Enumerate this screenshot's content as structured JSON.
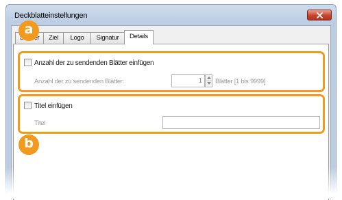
{
  "window": {
    "title": "Deckblatteinstellungen"
  },
  "tabs": [
    {
      "label": "Sender",
      "active": false
    },
    {
      "label": "Ziel",
      "active": false
    },
    {
      "label": "Logo",
      "active": false
    },
    {
      "label": "Signatur",
      "active": false
    },
    {
      "label": "Details",
      "active": true
    }
  ],
  "badges": {
    "a": "a",
    "b": "b"
  },
  "sheet_count": {
    "checkbox_label": "Anzahl der zu sendenden Blätter einfügen",
    "checked": false,
    "field_label": "Anzahl der zu sendenden Blätter:",
    "value": "1",
    "unit_hint": "Blätter [1 bis 9999]"
  },
  "title_section": {
    "checkbox_label": "Titel einfügen",
    "checked": false,
    "field_label": "Titel",
    "value": ""
  },
  "colors": {
    "highlight": "#f29a1e",
    "close_button": "#c8432c",
    "title_bar": "#c5d5e8"
  }
}
